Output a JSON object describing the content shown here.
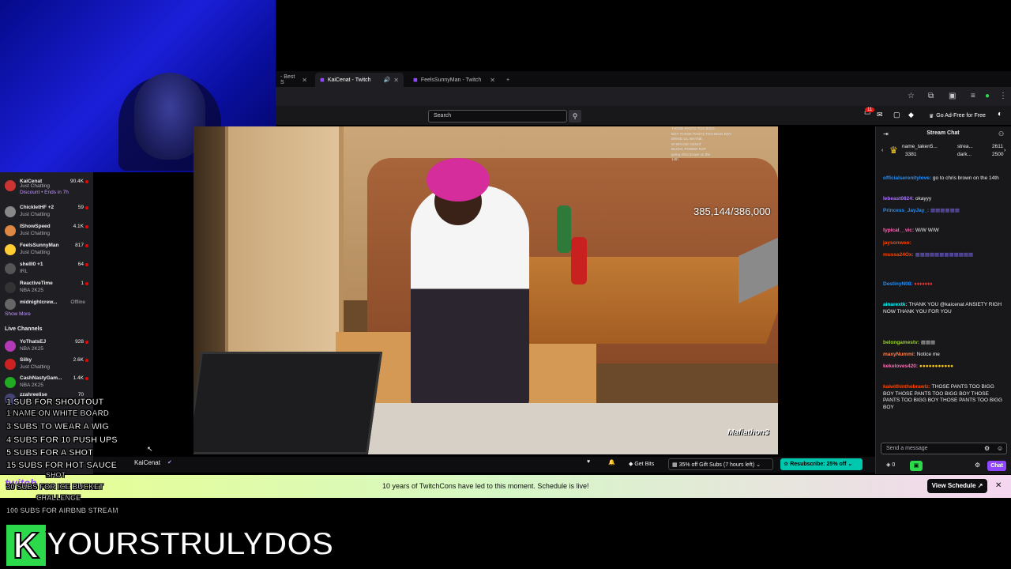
{
  "browser": {
    "tabs": [
      {
        "label": "- Best S",
        "active": false
      },
      {
        "label": "KaiCenat - Twitch",
        "active": true
      },
      {
        "label": "FeelsSunnyMan - Twitch",
        "active": false
      }
    ],
    "new_tab": "+"
  },
  "topnav": {
    "search_placeholder": "Search",
    "notifications_count": "11",
    "ad_free": "Go Ad-Free for Free"
  },
  "sidebar": {
    "channels": [
      {
        "name": "KaiCenat",
        "game": "Discount • Ends in 7h",
        "status": "Just Chatting",
        "viewers": "90.4K"
      },
      {
        "name": "ChickletHF +2",
        "game": "Just Chatting",
        "viewers": "59"
      },
      {
        "name": "IShowSpeed",
        "game": "Just Chatting",
        "viewers": "4.1K"
      },
      {
        "name": "FeelsSunnyMan",
        "game": "Just Chatting",
        "viewers": "817"
      },
      {
        "name": "shelll0 +1",
        "game": "IRL",
        "viewers": "64"
      },
      {
        "name": "ReactiveTime",
        "game": "NBA 2K25",
        "viewers": "1"
      },
      {
        "name": "midnightcrew...",
        "game": "",
        "viewers": "Offline"
      }
    ],
    "show_more": "Show More",
    "live_channels_header": "Live Channels",
    "live_channels": [
      {
        "name": "YoThatsEJ",
        "game": "NBA 2K25",
        "viewers": "928"
      },
      {
        "name": "Silky",
        "game": "Just Chatting",
        "viewers": "2.6K"
      },
      {
        "name": "CashNastyGam...",
        "game": "NBA 2K25",
        "viewers": "1.4K"
      },
      {
        "name": "zzahreelise",
        "game": "",
        "viewers": "70"
      }
    ]
  },
  "video": {
    "counter": "385,144/386,000",
    "watermark": "Mafiathon3",
    "overlay_chat": [
      "THOSE PANTS TOO BIGG",
      "BOY THOSE PANTS TOO BIGG BOY",
      "BRING LIL WAYNE",
      "W MOUSE CENAT",
      "BLOCK POWER RAP",
      "going chris brown on the",
      "14th"
    ]
  },
  "overlay_list": [
    "1 SUB FOR SHOUTOUT",
    "1 NAME ON WHITE BOARD",
    "3 SUBS TO WEAR A WIG",
    "4 SUBS FOR 10 PUSH UPS",
    "5 SUBS FOR A SHOT",
    "15 SUBS FOR HOT SAUCE",
    "SHOT",
    "30 SUBS FOR ICE BUCKET",
    "CHALLENGE",
    "100 SUBS FOR AIRBNB STREAM"
  ],
  "stream_title_overlay": {
    "k": "K",
    "text": "YOURSTRULYDOS"
  },
  "streaminfo": {
    "streamer": "KaiCenat",
    "get_bits": "Get Bits",
    "gift_subs": "35% off Gift Subs (7 hours left)",
    "resubscribe": "Resubscribe: 25% off"
  },
  "banner": {
    "text": "10 years of TwitchCons have led to this moment. Schedule is live!",
    "button": "View Schedule ↗",
    "close": "✕"
  },
  "chat": {
    "header": "Stream Chat",
    "top_subs": [
      {
        "name": "name_taken5...",
        "count": "3381"
      },
      {
        "name": "strea...",
        "count": "2611"
      },
      {
        "name": "dark...",
        "count": "2500"
      }
    ],
    "messages": [
      {
        "user": "officialserenitylove:",
        "text": "go to chris brown on the 14th",
        "color": "#1e90ff"
      },
      {
        "user": "lebeast0824:",
        "text": "okayyy",
        "color": "#a970ff"
      },
      {
        "user": "Princess_JayJay_:",
        "text": "",
        "color": "#1e90ff"
      },
      {
        "user": "typical__vic:",
        "text": "W/W W/W",
        "color": "#ff69b4"
      },
      {
        "user": "jaysonwoo:",
        "text": "",
        "color": "#ff4500"
      },
      {
        "user": "mussa24Ox:",
        "text": "",
        "color": "#ff4500"
      },
      {
        "user": "DestinyN08:",
        "text": "",
        "color": "#1e90ff"
      },
      {
        "user": "ainarextk:",
        "text": "THANK YOU @kaicenat ANSIETY RIGH NOW THANK YOU FOR YOU",
        "color": "#00ffff"
      },
      {
        "user": "belongamestv:",
        "text": "",
        "color": "#9acd32"
      },
      {
        "user": "maxyNummi:",
        "text": "Notice me",
        "color": "#ff7f50"
      },
      {
        "user": "kekeloves420:",
        "text": "",
        "color": "#ff69b4"
      },
      {
        "user": "kaiwithinthebrawlz:",
        "text": "THOSE PANTS TOO BIGG BOY THOSE PANTS TOO BIGG BOY THOSE PANTS TOO BIGG BOY THOSE PANTS TOO BIGG BOY",
        "color": "#ff4500"
      }
    ],
    "input_placeholder": "Send a message",
    "points": "0",
    "chat_button": "Chat"
  }
}
